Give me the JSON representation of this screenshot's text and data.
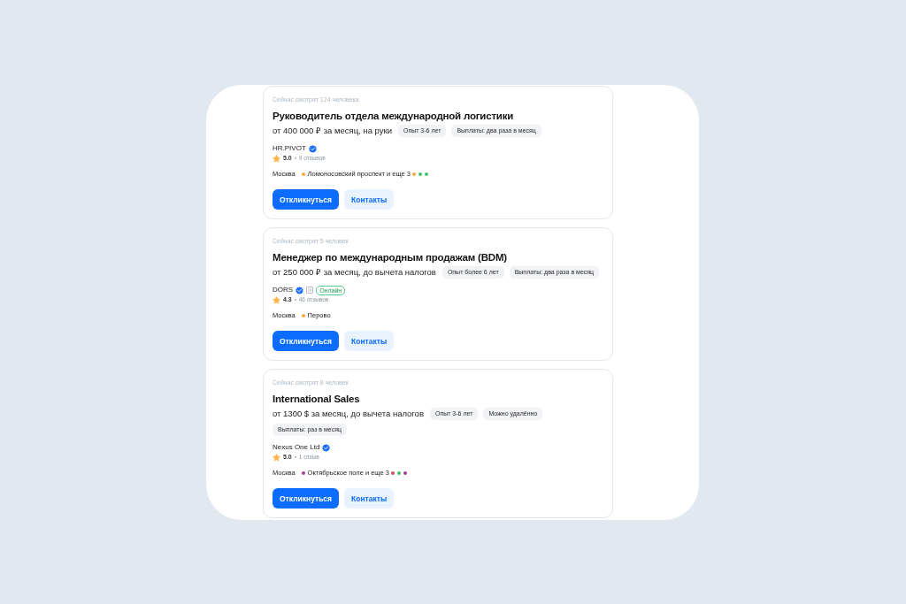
{
  "vacancies": [
    {
      "viewers": "Сейчас смотрят 124 человека",
      "title": "Руководитель отдела международной логистики",
      "salary": "от 400 000 ₽ за месяц, на руки",
      "tags": [
        "Опыт 3-6 лет",
        "Выплаты: два раза в месяц"
      ],
      "company": {
        "name": "HR.PIVOT",
        "verified": true
      },
      "rating": {
        "value": "5.0",
        "reviews": "9 отзывов"
      },
      "location": {
        "city": "Москва",
        "station": {
          "name": "Ломоносовский проспект и еще 3",
          "color": "#f6a93b"
        },
        "more_lines": [
          {
            "color": "#f6a93b"
          },
          {
            "color": "#3cc46c"
          },
          {
            "color": "#3cc46c"
          }
        ]
      },
      "buttons": [
        {
          "label": "Откликнуться",
          "kind": "primary"
        },
        {
          "label": "Контакты",
          "kind": "secondary"
        }
      ]
    },
    {
      "viewers": "Сейчас смотрят 5 человек",
      "title": "Менеджер по международным продажам (BDM)",
      "salary": "от 250 000 ₽ за месяц, до вычета налогов",
      "tags": [
        "Опыт более 6 лет",
        "Выплаты: два раза в месяц"
      ],
      "company": {
        "name": "DORS",
        "verified": true,
        "badges": [
          {
            "kind": "icon"
          },
          {
            "kind": "pill",
            "text": "Онлайн"
          }
        ]
      },
      "rating": {
        "value": "4.3",
        "reviews": "46 отзывов"
      },
      "location": {
        "city": "Москва",
        "station": {
          "name": "Перово",
          "color": "#f6a93b"
        }
      },
      "buttons": [
        {
          "label": "Откликнуться",
          "kind": "primary"
        },
        {
          "label": "Контакты",
          "kind": "secondary"
        }
      ]
    },
    {
      "viewers": "Сейчас смотрят 8 человек",
      "title": "International Sales",
      "salary": "от 1300 $ за месяц, до вычета налогов",
      "tags": [
        "Опыт 3-6 лет",
        "Можно удалённо",
        "Выплаты: раз в месяц"
      ],
      "company": {
        "name": "Nexus One Ltd",
        "verified": true
      },
      "rating": {
        "value": "5.0",
        "reviews": "1 отзыв"
      },
      "location": {
        "city": "Москва",
        "station": {
          "name": "Октябрьское поле и еще 3",
          "color": "#a5408f"
        },
        "more_lines": [
          {
            "color": "#d9485f"
          },
          {
            "color": "#3cc46c"
          },
          {
            "color": "#a5408f"
          }
        ]
      },
      "buttons": [
        {
          "label": "Откликнуться",
          "kind": "primary"
        },
        {
          "label": "Контакты",
          "kind": "secondary"
        }
      ]
    }
  ]
}
